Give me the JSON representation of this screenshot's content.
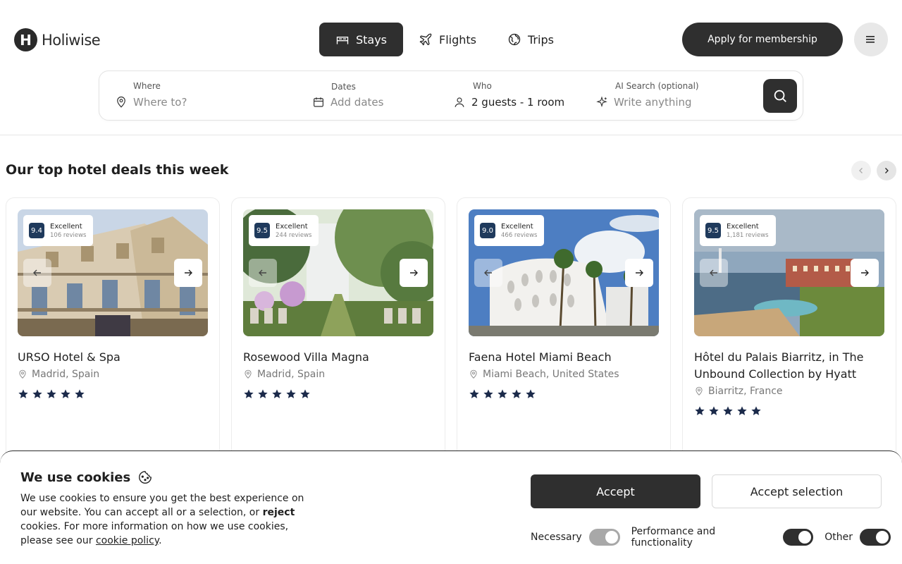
{
  "brand": {
    "name": "Holiwise",
    "mark": "H"
  },
  "nav": {
    "tabs": [
      {
        "label": "Stays",
        "icon": "bed-icon",
        "active": true
      },
      {
        "label": "Flights",
        "icon": "plane-icon",
        "active": false
      },
      {
        "label": "Trips",
        "icon": "globe-icon",
        "active": false
      }
    ],
    "apply_label": "Apply for membership"
  },
  "search": {
    "where": {
      "label": "Where",
      "placeholder": "Where to?"
    },
    "dates": {
      "label": "Dates",
      "placeholder": "Add dates"
    },
    "who": {
      "label": "Who",
      "value": "2 guests - 1 room"
    },
    "ai": {
      "label": "AI Search (optional)",
      "placeholder": "Write anything"
    }
  },
  "deals": {
    "title": "Our top hotel deals this week",
    "hotels": [
      {
        "score": "9.4",
        "rating_word": "Excellent",
        "reviews": "106 reviews",
        "name": "URSO Hotel & Spa",
        "location": "Madrid, Spain",
        "stars": 5
      },
      {
        "score": "9.5",
        "rating_word": "Excellent",
        "reviews": "244 reviews",
        "name": "Rosewood Villa Magna",
        "location": "Madrid, Spain",
        "stars": 5
      },
      {
        "score": "9.0",
        "rating_word": "Excellent",
        "reviews": "466 reviews",
        "name": "Faena Hotel Miami Beach",
        "location": "Miami Beach, United States",
        "stars": 5
      },
      {
        "score": "9.5",
        "rating_word": "Excellent",
        "reviews": "1,181 reviews",
        "name": "Hôtel du Palais Biarritz, in The Unbound Collection by Hyatt",
        "location": "Biarritz, France",
        "stars": 5
      }
    ]
  },
  "cookies": {
    "title": "We use cookies",
    "text_1": "We use cookies to ensure you get the best experience on our website. You can accept all or a selection, or ",
    "text_reject": "reject",
    "text_2": " cookies. For more information on how we use cookies, please see our ",
    "text_policy": "cookie policy",
    "text_3": ".",
    "accept_label": "Accept",
    "accept_selection_label": "Accept selection",
    "toggles": [
      {
        "label": "Necessary",
        "on": true,
        "disabled": true
      },
      {
        "label": "Performance and functionality",
        "on": true,
        "disabled": false
      },
      {
        "label": "Other",
        "on": true,
        "disabled": false
      }
    ]
  },
  "colors": {
    "dark": "#2f2f2f",
    "score_bg": "#1f3a5c",
    "star": "#1b2a4a"
  }
}
